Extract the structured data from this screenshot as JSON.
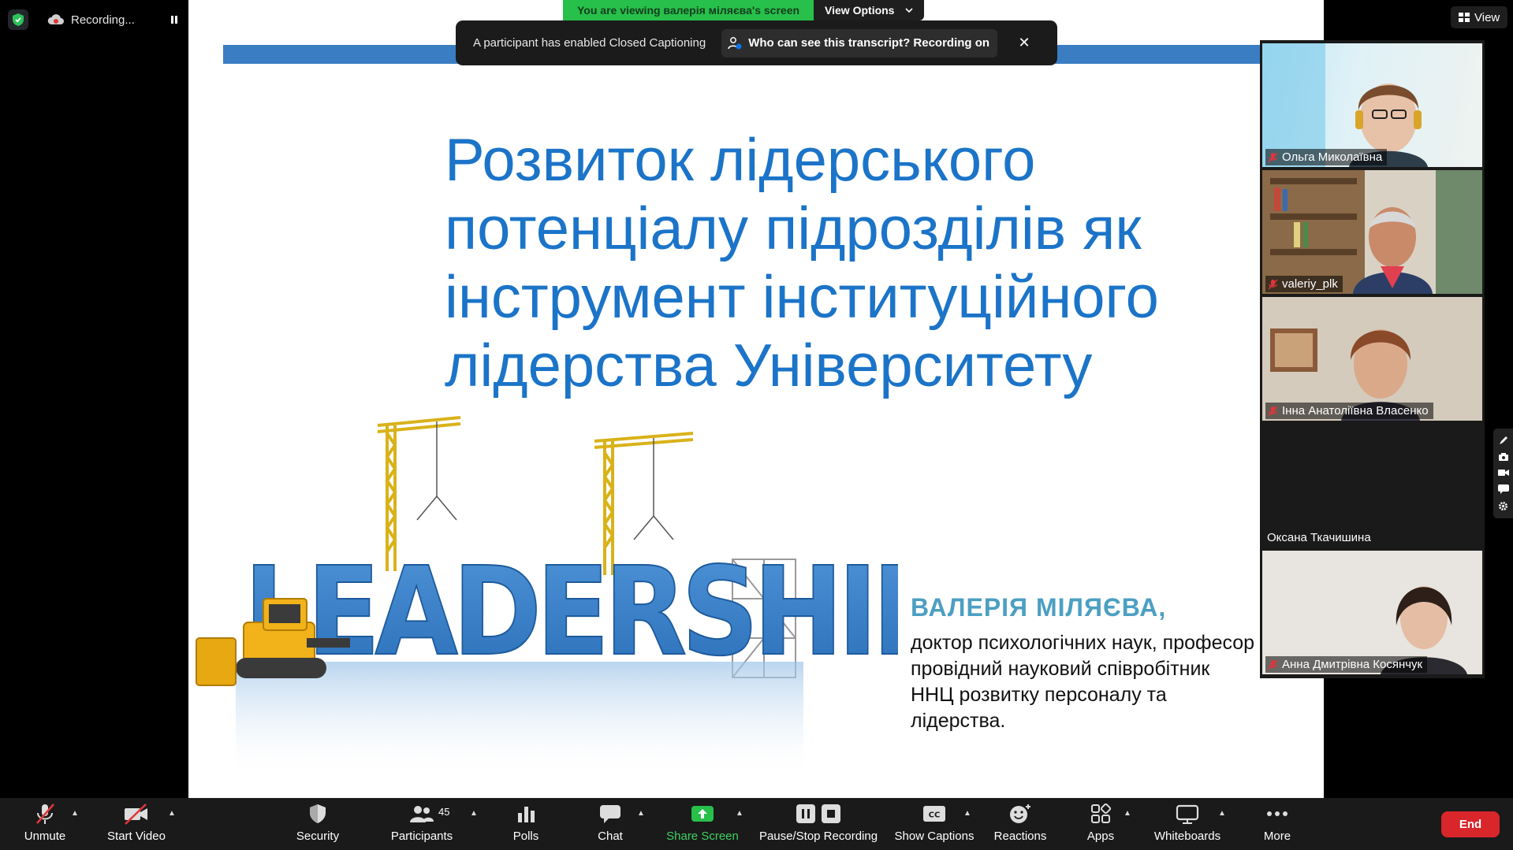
{
  "status": {
    "recording_label": "Recording..."
  },
  "banner": {
    "viewing_text": "You are viewing валерія міляєва's screen",
    "view_options_label": "View Options"
  },
  "toast": {
    "message": "A participant has enabled Closed Captioning",
    "transcript_label": "Who can see this transcript? Recording on"
  },
  "view_button": {
    "label": "View"
  },
  "slide": {
    "title_lines": [
      "Розвиток лідерського",
      "потенціалу підрозділів як",
      "інструмент інституційного",
      "лідерства Університету"
    ],
    "art_word": "LEADERSHIP",
    "author": "ВАЛЕРІЯ МІЛЯЄВА,",
    "desc_lines": [
      "доктор психологічних наук, професор",
      "провідний науковий співробітник",
      "ННЦ розвитку персоналу та",
      "лідерства."
    ]
  },
  "participants": [
    {
      "name": "Ольга Миколаївна",
      "muted": true
    },
    {
      "name": "valeriy_plk",
      "muted": true
    },
    {
      "name": "Інна Анатоліївна Власенко",
      "muted": true
    },
    {
      "name": "Оксана Ткачишина",
      "muted": false
    },
    {
      "name": "Анна Дмитрівна Косянчук",
      "muted": true
    }
  ],
  "toolbar": {
    "unmute": "Unmute",
    "start_video": "Start Video",
    "security": "Security",
    "participants": "Participants",
    "participants_count": "45",
    "polls": "Polls",
    "chat": "Chat",
    "share_screen": "Share Screen",
    "pause_stop_recording": "Pause/Stop Recording",
    "show_captions": "Show Captions",
    "reactions": "Reactions",
    "apps": "Apps",
    "whiteboards": "Whiteboards",
    "more": "More",
    "end": "End"
  },
  "colors": {
    "accent_green": "#27c04a",
    "end_red": "#d9262b",
    "slide_title_blue": "#1b74c8",
    "author_teal": "#4c9fc2"
  }
}
